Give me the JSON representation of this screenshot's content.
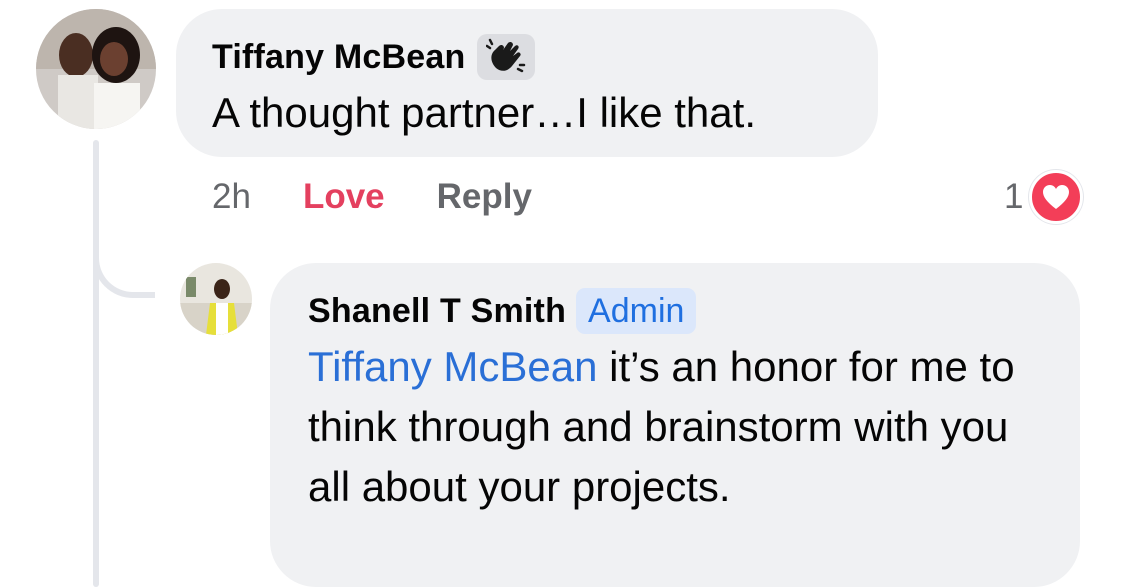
{
  "comment": {
    "author": "Tiffany McBean",
    "badge_icon": "waving-hand-icon",
    "text": "A thought partner…I like that.",
    "time": "2h",
    "love_label": "Love",
    "reply_label": "Reply",
    "reaction_count": "1",
    "reaction_icon": "heart-icon",
    "reaction_color": "#f33e58"
  },
  "reply": {
    "author": "Shanell T Smith",
    "badge": "Admin",
    "mention": "Tiffany McBean",
    "text": " it’s an honor for me to think through and brainstorm with you all about your projects."
  },
  "colors": {
    "bubble": "#f0f1f3",
    "love": "#e4405f",
    "mention": "#2a6fd6",
    "admin_badge_bg": "#dbe7fb"
  }
}
